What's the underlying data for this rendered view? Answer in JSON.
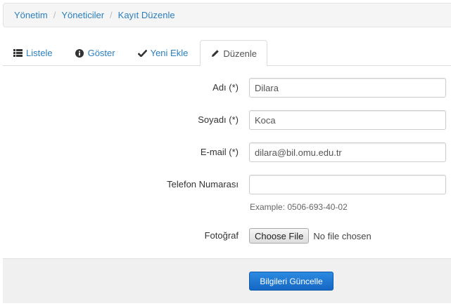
{
  "breadcrumb": {
    "items": [
      "Yönetim",
      "Yöneticiler",
      "Kayıt Düzenle"
    ],
    "separator": "/"
  },
  "tabs": [
    {
      "label": "Listele",
      "icon": "list-icon",
      "active": false
    },
    {
      "label": "Göster",
      "icon": "info-circle-icon",
      "active": false
    },
    {
      "label": "Yeni Ekle",
      "icon": "check-icon",
      "active": false
    },
    {
      "label": "Düzenle",
      "icon": "pencil-icon",
      "active": true
    }
  ],
  "form": {
    "first_name": {
      "label": "Adı (*)",
      "value": "Dilara"
    },
    "last_name": {
      "label": "Soyadı (*)",
      "value": "Koca"
    },
    "email": {
      "label": "E-mail (*)",
      "value": "dilara@bil.omu.edu.tr"
    },
    "phone": {
      "label": "Telefon Numarası",
      "value": "",
      "help": "Example: 0506-693-40-02"
    },
    "photo": {
      "label": "Fotoğraf",
      "button": "Choose File",
      "status": "No file chosen"
    }
  },
  "actions": {
    "submit_label": "Bilgileri Güncelle"
  },
  "colors": {
    "link": "#2a7fbf",
    "primary_button": "#1a73d0"
  }
}
